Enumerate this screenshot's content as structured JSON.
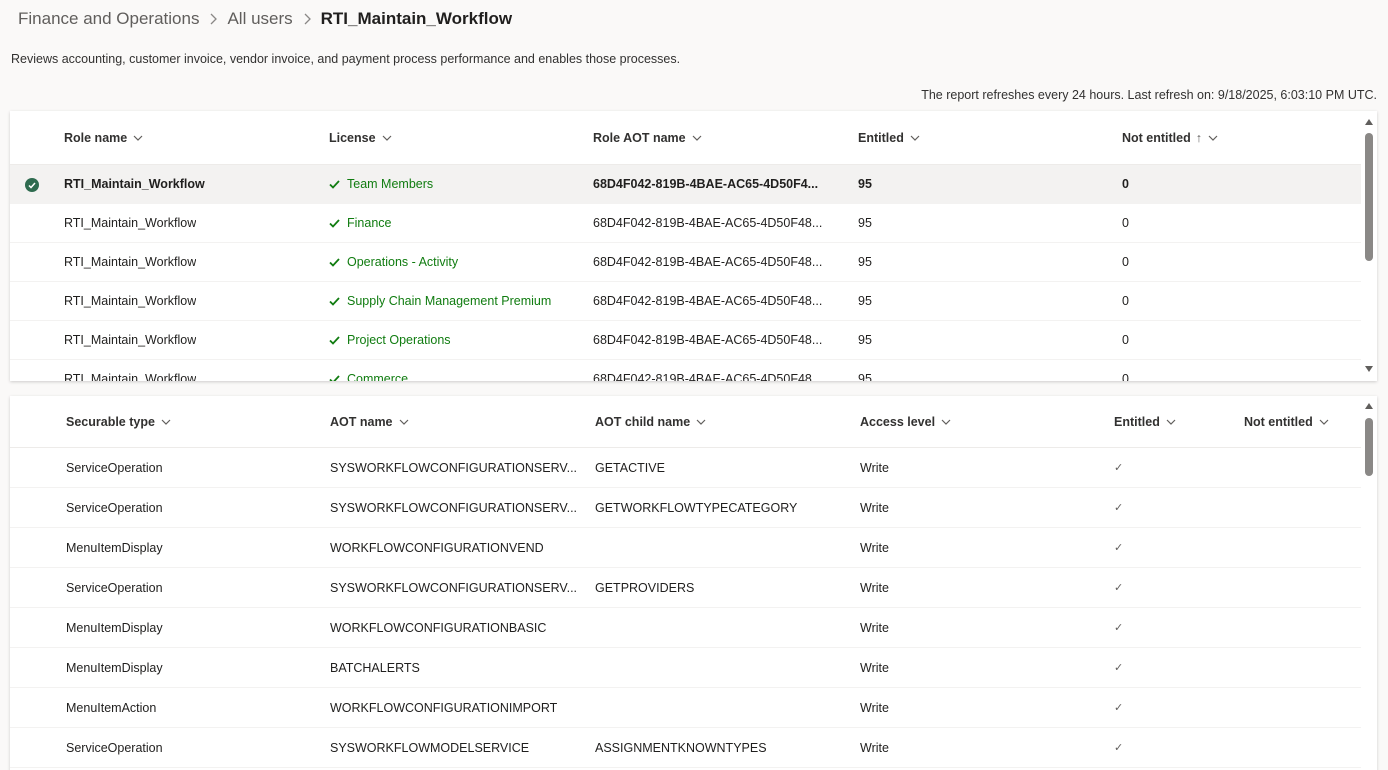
{
  "breadcrumb": {
    "items": [
      "Finance and Operations",
      "All users"
    ],
    "current": "RTI_Maintain_Workflow"
  },
  "description": "Reviews accounting, customer invoice, vendor invoice, and payment process performance and enables those processes.",
  "refresh_text": "The report refreshes every 24 hours. Last refresh on: 9/18/2025, 6:03:10 PM UTC.",
  "roles_table": {
    "headers": {
      "role_name": "Role name",
      "license": "License",
      "role_aot_name": "Role AOT name",
      "entitled": "Entitled",
      "not_entitled": "Not entitled",
      "sort_indicator": "↑"
    },
    "rows": [
      {
        "role_name": "RTI_Maintain_Workflow",
        "license": "Team Members",
        "role_aot_name": "68D4F042-819B-4BAE-AC65-4D50F4...",
        "entitled": "95",
        "not_entitled": "0"
      },
      {
        "role_name": "RTI_Maintain_Workflow",
        "license": "Finance",
        "role_aot_name": "68D4F042-819B-4BAE-AC65-4D50F48...",
        "entitled": "95",
        "not_entitled": "0"
      },
      {
        "role_name": "RTI_Maintain_Workflow",
        "license": "Operations - Activity",
        "role_aot_name": "68D4F042-819B-4BAE-AC65-4D50F48...",
        "entitled": "95",
        "not_entitled": "0"
      },
      {
        "role_name": "RTI_Maintain_Workflow",
        "license": "Supply Chain Management Premium",
        "role_aot_name": "68D4F042-819B-4BAE-AC65-4D50F48...",
        "entitled": "95",
        "not_entitled": "0"
      },
      {
        "role_name": "RTI_Maintain_Workflow",
        "license": "Project Operations",
        "role_aot_name": "68D4F042-819B-4BAE-AC65-4D50F48...",
        "entitled": "95",
        "not_entitled": "0"
      },
      {
        "role_name": "RTI_Maintain_Workflow",
        "license": "Commerce",
        "role_aot_name": "68D4F042-819B-4BAE-AC65-4D50F48...",
        "entitled": "95",
        "not_entitled": "0"
      }
    ]
  },
  "securables_table": {
    "headers": {
      "securable_type": "Securable type",
      "aot_name": "AOT name",
      "aot_child_name": "AOT child name",
      "access_level": "Access level",
      "entitled": "Entitled",
      "not_entitled": "Not entitled"
    },
    "rows": [
      {
        "securable_type": "ServiceOperation",
        "aot_name": "SYSWORKFLOWCONFIGURATIONSERV...",
        "aot_child_name": "GETACTIVE",
        "access_level": "Write",
        "entitled": "✓"
      },
      {
        "securable_type": "ServiceOperation",
        "aot_name": "SYSWORKFLOWCONFIGURATIONSERV...",
        "aot_child_name": "GETWORKFLOWTYPECATEGORY",
        "access_level": "Write",
        "entitled": "✓"
      },
      {
        "securable_type": "MenuItemDisplay",
        "aot_name": "WORKFLOWCONFIGURATIONVEND",
        "aot_child_name": "",
        "access_level": "Write",
        "entitled": "✓"
      },
      {
        "securable_type": "ServiceOperation",
        "aot_name": "SYSWORKFLOWCONFIGURATIONSERV...",
        "aot_child_name": "GETPROVIDERS",
        "access_level": "Write",
        "entitled": "✓"
      },
      {
        "securable_type": "MenuItemDisplay",
        "aot_name": "WORKFLOWCONFIGURATIONBASIC",
        "aot_child_name": "",
        "access_level": "Write",
        "entitled": "✓"
      },
      {
        "securable_type": "MenuItemDisplay",
        "aot_name": "BATCHALERTS",
        "aot_child_name": "",
        "access_level": "Write",
        "entitled": "✓"
      },
      {
        "securable_type": "MenuItemAction",
        "aot_name": "WORKFLOWCONFIGURATIONIMPORT",
        "aot_child_name": "",
        "access_level": "Write",
        "entitled": "✓"
      },
      {
        "securable_type": "ServiceOperation",
        "aot_name": "SYSWORKFLOWMODELSERVICE",
        "aot_child_name": "ASSIGNMENTKNOWNTYPES",
        "access_level": "Write",
        "entitled": "✓"
      }
    ]
  },
  "colors": {
    "license_green": "#107c10",
    "selected_circle": "#2e6b4f"
  }
}
